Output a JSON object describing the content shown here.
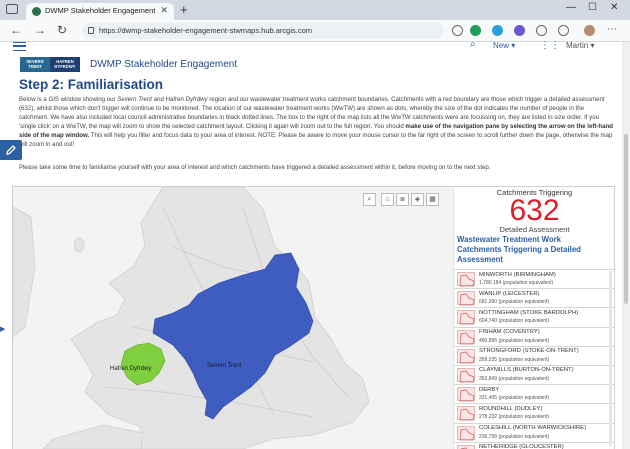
{
  "browser": {
    "tab_title": "DWMP Stakeholder Engagement",
    "url": "https://dwmp-stakeholder-engagement-stwmaps.hub.arcgis.com"
  },
  "topnav": {
    "new_label": "New",
    "user_name": "Martin"
  },
  "header": {
    "logo_left": "SEVERN TRENT",
    "logo_right": "HAFREN DYFRDWY",
    "site_title": "DWMP Stakeholder Engagement"
  },
  "content": {
    "step_title": "Step 2: Familiarisation",
    "intro_p1": "Below is a GIS window showing our ",
    "intro_em": "Severn Trent",
    "intro_and": " and ",
    "intro_em2": "Hafren Dyfrdwy",
    "intro_p2": " region and our wastewater treatment works catchment boundaries.  Catchments with a red boundary are those which trigger a detailed assessment (632), whilst those which don't trigger will continue to be monitored.  The location of our wastewater treatment works (WwTW) are shown as dots, whereby the size of the dot indicates the number of people in the catchment. We have also included local council administrative boundaries in black dotted lines.  The box to the right of the map lists all the WwTW catchments were are focussing on, they are listed in size order.  If you 'single click' on a WwTW, the map will zoom to show the selected catchment layout.  Clicking it again will zoom out to the full region. You should ",
    "intro_bold": "make use of the navigation pane by selecting the arrow on the left-hand side of the map window.",
    "intro_p3": "  This will help you filter and focus data to your area of interest.  NOTE: Please be aware to move your mouse cursor to the far right of the screen to scroll further down the page, otherwise the map will zoom in and out!",
    "intro_line2": "Please take some time to familiarise yourself with your area of interest and which catchments have triggered a detailed assessment within it, before moving on to the next step."
  },
  "map": {
    "label_hafren": "Hafren Dyfrdwy",
    "label_severn": "Severn Trent",
    "colors": {
      "severn": "#3f5cc1",
      "hafren": "#7fcf3f",
      "sea": "#f2f2f2",
      "land": "#e4e4e4"
    }
  },
  "panel": {
    "counter_title": "Catchments Triggering",
    "counter_value": "632",
    "counter_caption": "Detailed Assessment",
    "list_title": "Wastewater Treatment Work Catchments Triggering a Detailed Assessment",
    "items": [
      {
        "name": "MINWORTH (BIRMINGHAM)",
        "value": "1,780,184 (population equivalent)"
      },
      {
        "name": "WANLIP (LEICESTER)",
        "value": "681,990 (population equivalent)"
      },
      {
        "name": "NOTTINGHAM (STOKE BARDOLPH)",
        "value": "604,740 (population equivalent)"
      },
      {
        "name": "FINHAM (COVENTRY)",
        "value": "460,896 (population equivalent)"
      },
      {
        "name": "STRONGFORD (STOKE-ON-TRENT)",
        "value": "358,535 (population equivalent)"
      },
      {
        "name": "CLAYMILLS (BURTON-ON-TRENT)",
        "value": "352,849 (population equivalent)"
      },
      {
        "name": "DERBY",
        "value": "331,405 (population equivalent)"
      },
      {
        "name": "ROUNDHILL (DUDLEY)",
        "value": "278,232 (population equivalent)"
      },
      {
        "name": "COLESHILL (NORTH WARWICKSHIRE)",
        "value": "236,758 (population equivalent)"
      },
      {
        "name": "NETHERIDGE (GLOUCESTER)",
        "value": ""
      }
    ]
  }
}
